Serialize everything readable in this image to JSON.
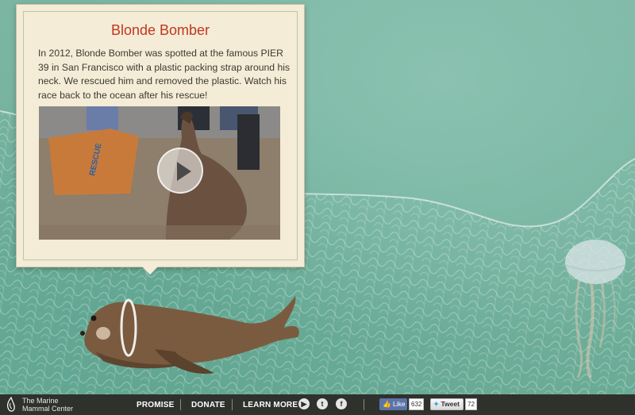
{
  "card": {
    "title": "Blonde Bomber",
    "text": "In 2012, Blonde Bomber was spotted at the famous PIER 39 in San Francisco with a plastic packing strap around his neck. We rescued him and removed the plastic. Watch his race back to the ocean after his rescue!",
    "video": {
      "board_text": "RESCUE"
    }
  },
  "footer": {
    "org_name_line1": "The Marine",
    "org_name_line2": "Mammal Center",
    "nav": [
      "PROMISE",
      "DONATE",
      "LEARN MORE"
    ],
    "social_icons": [
      "youtube-icon",
      "twitter-icon",
      "facebook-icon"
    ],
    "facebook": {
      "label": "Like",
      "count": "632"
    },
    "twitter": {
      "label": "Tweet",
      "count": "72"
    }
  },
  "colors": {
    "title": "#c0371f",
    "card_bg": "#f4ecd6",
    "ocean": "#7cb6a3",
    "footer_bg": "#2f312d",
    "facebook": "#5b74a8"
  }
}
